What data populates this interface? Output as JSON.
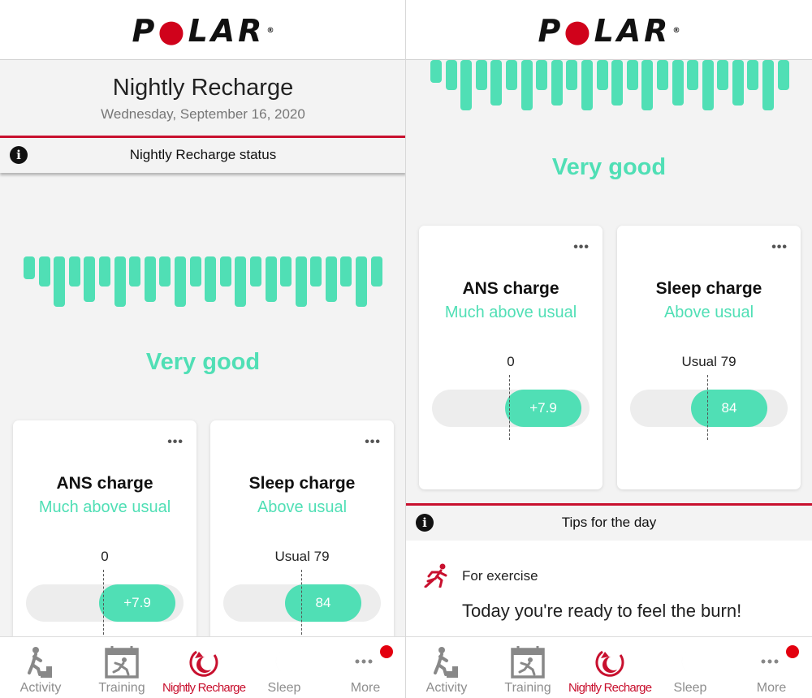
{
  "brand": {
    "logo_text": "P",
    "logo_dot": "●",
    "logo_rest": "LAR",
    "registered": "®"
  },
  "colors": {
    "accent": "#50dfb5",
    "brand_red": "#c8102e",
    "badge_red": "#e3000f"
  },
  "left": {
    "title": "Nightly Recharge",
    "date": "Wednesday, September 16, 2020",
    "status_label": "Nightly Recharge status",
    "verdict": "Very good"
  },
  "right": {
    "verdict": "Very good",
    "tips_label": "Tips for the day",
    "tip": {
      "icon": "running-person-icon",
      "category": "For exercise",
      "text": "Today you're ready to feel the burn!"
    }
  },
  "recharge_bars": [
    0.45,
    0.6,
    1.0,
    0.6,
    0.9,
    0.6,
    1.0,
    0.6,
    0.9,
    0.6,
    1.0,
    0.6,
    0.9,
    0.6,
    1.0,
    0.6,
    0.9,
    0.6,
    1.0,
    0.6,
    0.9,
    0.6,
    1.0,
    0.6
  ],
  "info_icon": "i",
  "cards": {
    "ans": {
      "title": "ANS charge",
      "subtitle": "Much above usual",
      "reference_label": "0",
      "value": "+7.9",
      "menu": "•••"
    },
    "sleep": {
      "title": "Sleep charge",
      "subtitle": "Above usual",
      "reference_label": "Usual 79",
      "value": "84",
      "menu": "•••"
    }
  },
  "nav": [
    {
      "label": "Activity",
      "icon": "activity-stairs-icon",
      "active": false
    },
    {
      "label": "Training",
      "icon": "training-calendar-icon",
      "active": false
    },
    {
      "label": "Nightly Recharge",
      "icon": "nightly-recharge-icon",
      "active": true
    },
    {
      "label": "Sleep",
      "icon": "moon-icon",
      "active": false
    },
    {
      "label": "More",
      "icon": "more-dots-icon",
      "active": false,
      "badge": true
    }
  ]
}
